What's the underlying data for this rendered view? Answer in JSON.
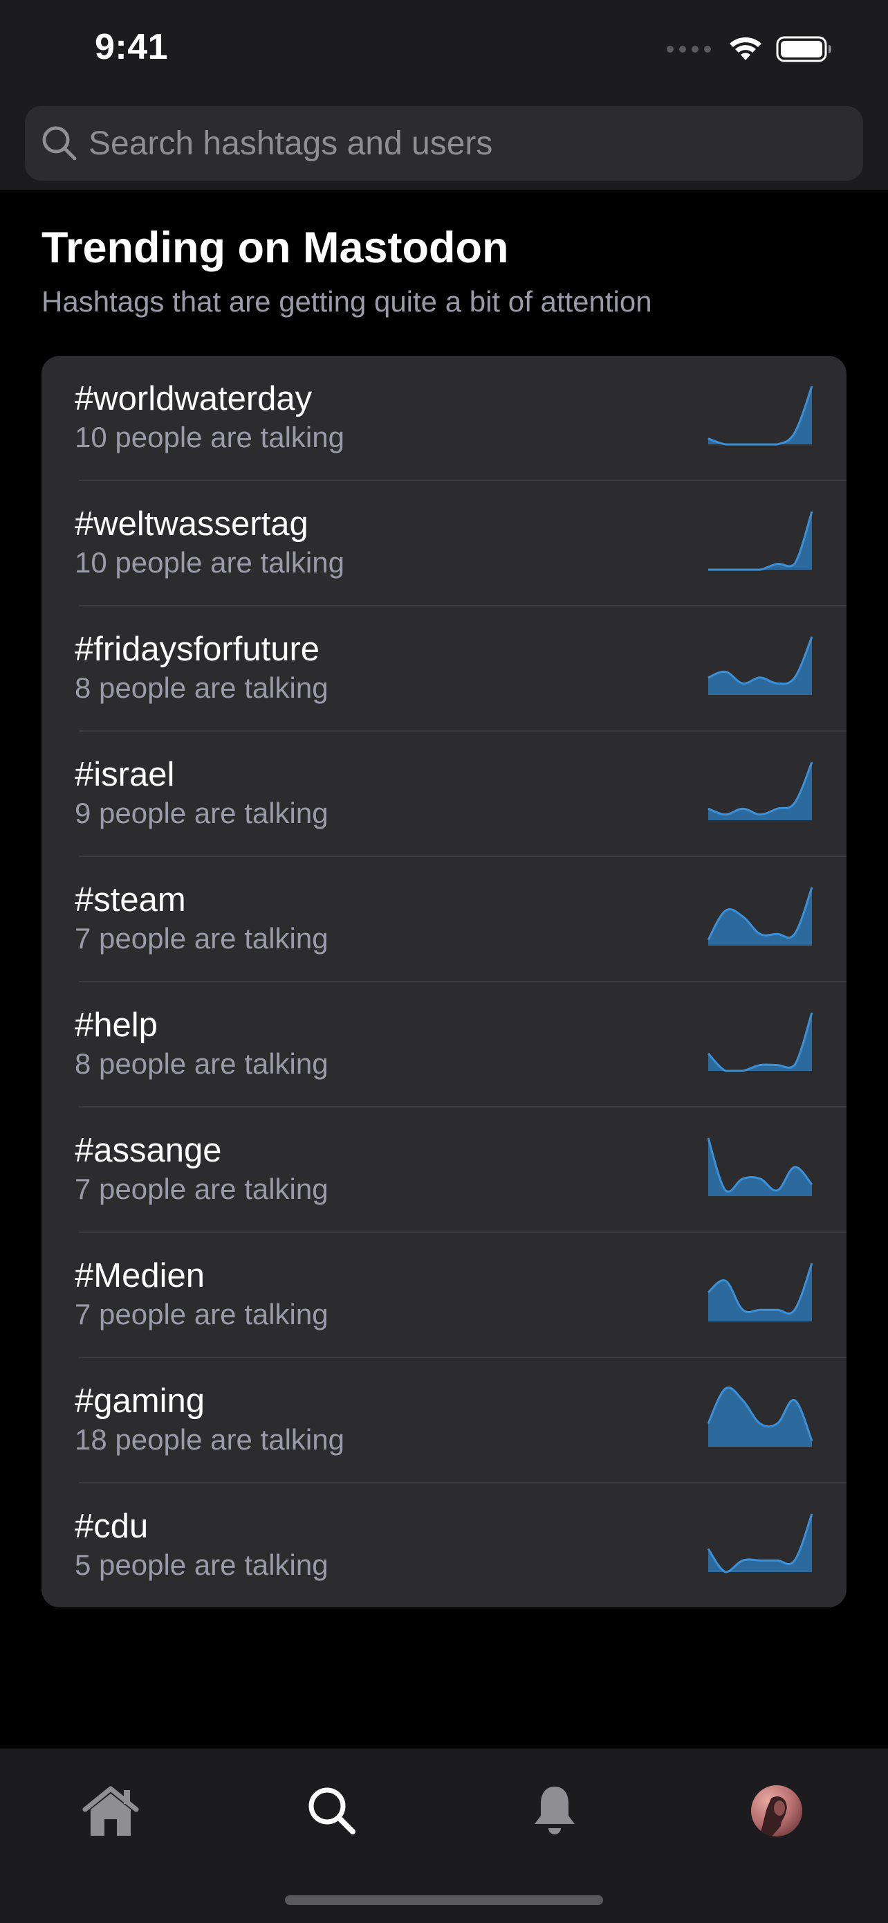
{
  "status_bar": {
    "time": "9:41"
  },
  "search": {
    "placeholder": "Search hashtags and users",
    "value": ""
  },
  "header": {
    "title": "Trending on Mastodon",
    "subtitle": "Hashtags that are getting quite a bit of attention"
  },
  "trends": [
    {
      "tag": "#worldwaterday",
      "count": "10 people are talking",
      "history": [
        1,
        0,
        0,
        0,
        0,
        2,
        10
      ]
    },
    {
      "tag": "#weltwassertag",
      "count": "10 people are talking",
      "history": [
        0,
        0,
        0,
        0,
        1,
        1,
        10
      ]
    },
    {
      "tag": "#fridaysforfuture",
      "count": "8 people are talking",
      "history": [
        3,
        4,
        2,
        3,
        2,
        3,
        10
      ]
    },
    {
      "tag": "#israel",
      "count": "9 people are talking",
      "history": [
        2,
        1,
        2,
        1,
        2,
        3,
        10
      ]
    },
    {
      "tag": "#steam",
      "count": "7 people are talking",
      "history": [
        1,
        6,
        5,
        2,
        2,
        2,
        10
      ]
    },
    {
      "tag": "#help",
      "count": "8 people are talking",
      "history": [
        3,
        0,
        0,
        1,
        1,
        1,
        10
      ]
    },
    {
      "tag": "#assange",
      "count": "7 people are talking",
      "history": [
        10,
        1,
        3,
        3,
        1,
        5,
        2
      ]
    },
    {
      "tag": "#Medien",
      "count": "7 people are talking",
      "history": [
        5,
        7,
        2,
        2,
        2,
        2,
        10
      ]
    },
    {
      "tag": "#gaming",
      "count": "18 people are talking",
      "history": [
        4,
        10,
        8,
        4,
        4,
        8,
        1
      ]
    },
    {
      "tag": "#cdu",
      "count": "5 people are talking",
      "history": [
        4,
        0,
        2,
        2,
        2,
        2,
        10
      ]
    }
  ],
  "tabbar": {
    "items": [
      {
        "name": "home",
        "icon": "home-icon",
        "active": false
      },
      {
        "name": "search",
        "icon": "search-icon",
        "active": true
      },
      {
        "name": "notifications",
        "icon": "bell-icon",
        "active": false
      },
      {
        "name": "profile",
        "icon": "avatar",
        "active": false
      }
    ]
  },
  "colors": {
    "spark_stroke": "#3d8fd6",
    "spark_fill": "#2c6a9e",
    "background": "#000000",
    "card": "#2c2c2e",
    "bar": "#1c1c1e"
  }
}
